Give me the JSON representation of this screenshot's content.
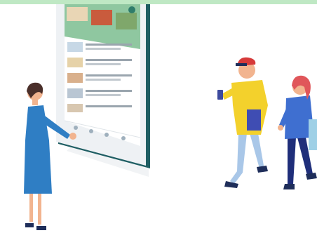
{
  "colors": {
    "top_bar": "#bfe8c4",
    "tablet_frame": "#eef1f4",
    "tablet_edge": "#1f5e63",
    "screen_bg": "#ffffff",
    "header_green": "#2f7d6b",
    "woman_dress": "#2f7ec4",
    "man_shirt": "#f3d12c",
    "man_pants": "#a9c7e8",
    "man_cap": "#d63a3a",
    "girl_top": "#3f6fd0",
    "girl_pants": "#1f2e7a",
    "girl_hair": "#e0565a",
    "skin": "#f2b48f",
    "dark_hair": "#4a2f2a"
  },
  "illustration": {
    "figures": [
      "woman-presenter",
      "young-man-with-phone",
      "young-woman-with-bag"
    ],
    "device": "tablet-news-feed"
  }
}
